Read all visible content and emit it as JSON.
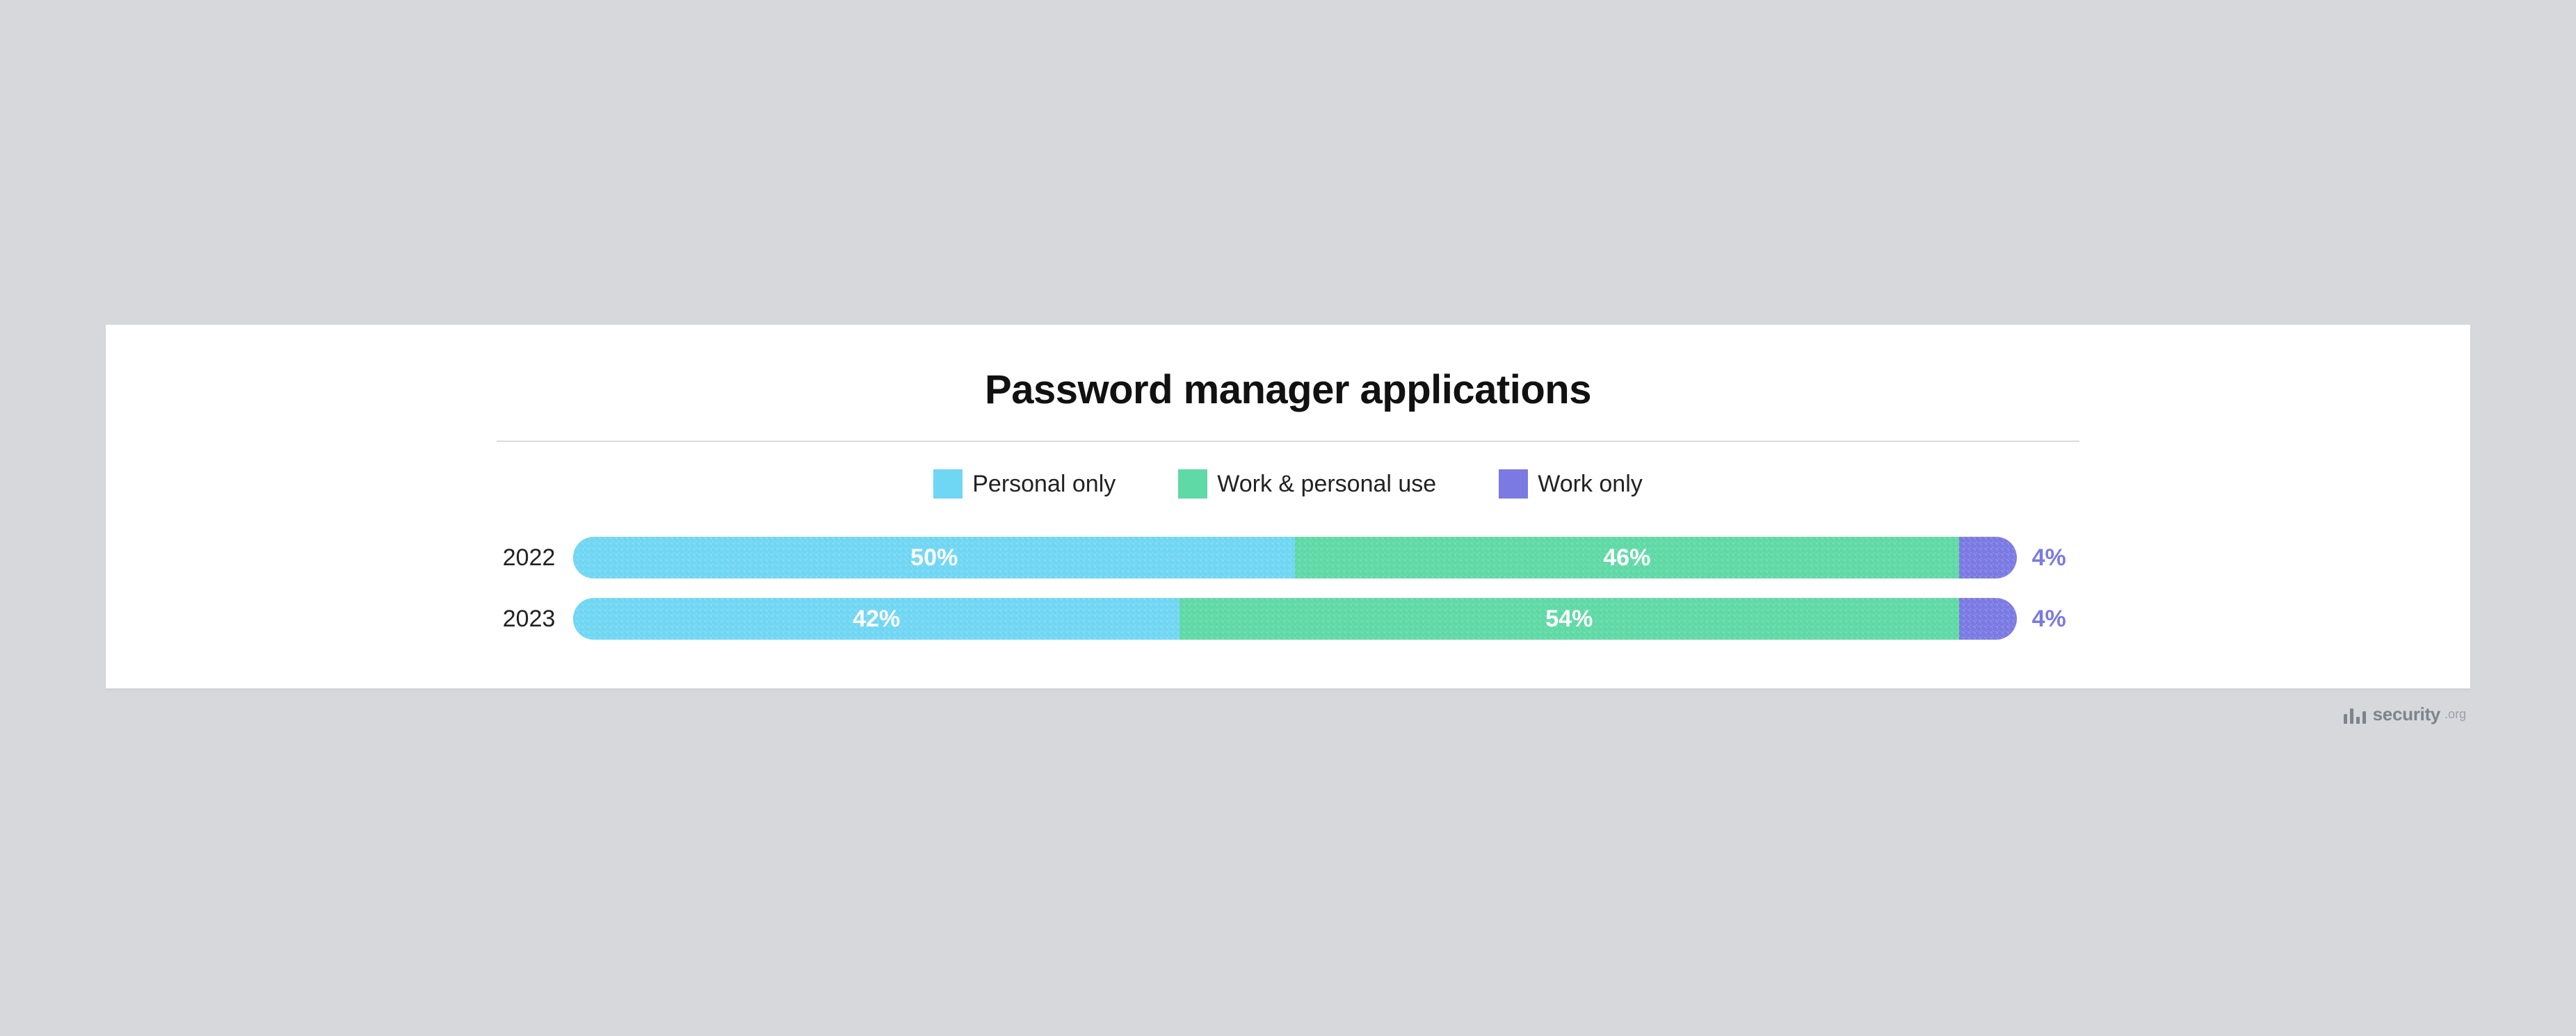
{
  "title": "Password manager applications",
  "legend": [
    {
      "label": "Personal only",
      "color": "#6fd6f3"
    },
    {
      "label": "Work & personal use",
      "color": "#5fd9a6"
    },
    {
      "label": "Work only",
      "color": "#7b7ae3"
    }
  ],
  "rows": [
    {
      "label": "2022",
      "segments": [
        {
          "series": "Personal only",
          "value": 50,
          "text": "50%"
        },
        {
          "series": "Work & personal use",
          "value": 46,
          "text": "46%"
        },
        {
          "series": "Work only",
          "value": 4,
          "text": "4%",
          "external": true
        }
      ]
    },
    {
      "label": "2023",
      "segments": [
        {
          "series": "Personal only",
          "value": 42,
          "text": "42%"
        },
        {
          "series": "Work & personal use",
          "value": 54,
          "text": "54%"
        },
        {
          "series": "Work only",
          "value": 4,
          "text": "4%",
          "external": true
        }
      ]
    }
  ],
  "attribution": {
    "brand": "security",
    "suffix": ".org"
  },
  "chart_data": {
    "type": "bar",
    "stacked": true,
    "orientation": "horizontal",
    "title": "Password manager applications",
    "categories": [
      "2022",
      "2023"
    ],
    "series": [
      {
        "name": "Personal only",
        "values": [
          50,
          42
        ],
        "color": "#6fd6f3"
      },
      {
        "name": "Work & personal use",
        "values": [
          46,
          54
        ],
        "color": "#5fd9a6"
      },
      {
        "name": "Work only",
        "values": [
          4,
          4
        ],
        "color": "#7b7ae3"
      }
    ],
    "unit": "percent",
    "xlim": [
      0,
      100
    ]
  }
}
